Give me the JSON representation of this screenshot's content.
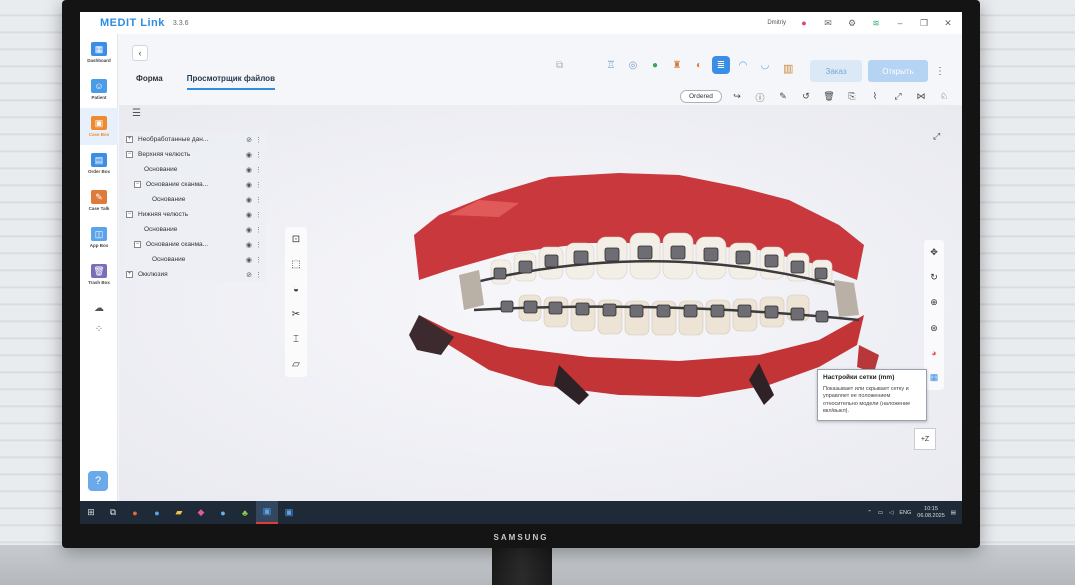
{
  "app": {
    "name": "MEDIT Link",
    "version": "3.3.6",
    "user": "Dmitriy"
  },
  "sidebar": {
    "items": [
      {
        "label": "Dashboard",
        "icon": "dashboard-icon",
        "color": "#3b8ee6"
      },
      {
        "label": "Patient",
        "icon": "patient-icon",
        "color": "#4a9be8"
      },
      {
        "label": "Case Box",
        "icon": "case-box-icon",
        "color": "#f08a30"
      },
      {
        "label": "Order Box",
        "icon": "order-box-icon",
        "color": "#3b8ee6"
      },
      {
        "label": "Case Talk",
        "icon": "case-talk-icon",
        "color": "#e07a3a"
      },
      {
        "label": "App Box",
        "icon": "app-box-icon",
        "color": "#5aa4ec"
      },
      {
        "label": "Trash Box",
        "icon": "trash-box-icon",
        "color": "#7d6cb8"
      }
    ]
  },
  "header": {
    "tabs": [
      {
        "label": "Форма"
      },
      {
        "label": "Просмотрщик файлов"
      }
    ],
    "order_button": "Заказ",
    "open_button": "Открыть",
    "status": "Ordered"
  },
  "tree": {
    "rows": [
      {
        "label": "Необработанные дан...",
        "indent": 0,
        "box": "+"
      },
      {
        "label": "Верхняя челюсть",
        "indent": 0,
        "box": "−"
      },
      {
        "label": "Основание",
        "indent": 2,
        "box": ""
      },
      {
        "label": "Основание сканма...",
        "indent": 1,
        "box": "−"
      },
      {
        "label": "Основание",
        "indent": 3,
        "box": ""
      },
      {
        "label": "Нижняя челюсть",
        "indent": 0,
        "box": "−"
      },
      {
        "label": "Основание",
        "indent": 2,
        "box": ""
      },
      {
        "label": "Основание сканма...",
        "indent": 1,
        "box": "−"
      },
      {
        "label": "Основание",
        "indent": 3,
        "box": ""
      },
      {
        "label": "Окклюзия",
        "indent": 0,
        "box": "+"
      }
    ]
  },
  "tooltip": {
    "title": "Настройки сетки (mm)",
    "body": "Показывает или скрывает сетку и управляет ее положением относительно модели (наложение вкл/выкл)."
  },
  "viewport": {
    "axis_label": "+Z"
  },
  "taskbar": {
    "language": "ENG",
    "time": "10:15",
    "date": "06.08.2025"
  },
  "monitor": {
    "brand": "SAMSUNG"
  },
  "colors": {
    "accent": "#2f8de4",
    "gum": "#c8383c",
    "tooth": "#f3eee6"
  }
}
